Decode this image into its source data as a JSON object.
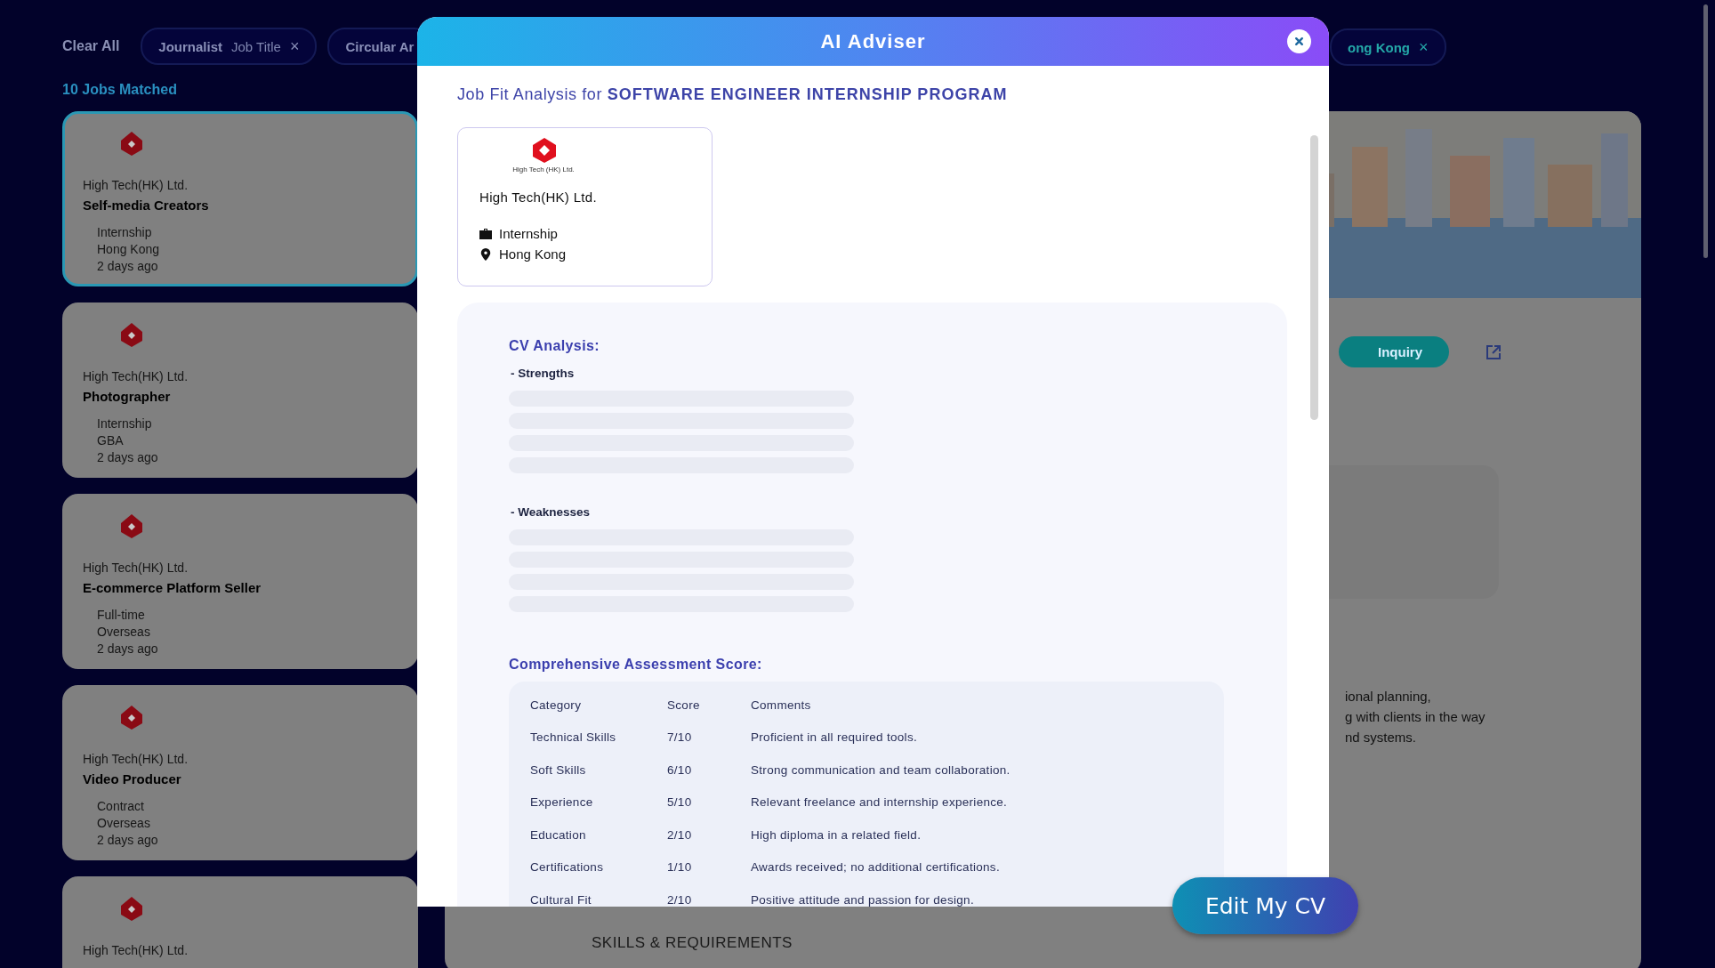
{
  "background": {
    "clear_label": "Clear All",
    "chips": [
      {
        "value": "Journalist",
        "field": "Job Title",
        "remove": "×"
      },
      {
        "value": "Circular Ar"
      }
    ],
    "right_chip": {
      "value": "ong Kong",
      "remove": "×"
    },
    "jobs_matched": "10 Jobs Matched",
    "jobs": [
      {
        "company": "High Tech(HK) Ltd.",
        "title": "Self-media Creators",
        "type": "Internship",
        "location": "Hong Kong",
        "posted": "2 days ago",
        "selected": true
      },
      {
        "company": "High Tech(HK) Ltd.",
        "title": "Photographer",
        "type": "Internship",
        "location": "GBA",
        "posted": "2 days ago",
        "selected": false
      },
      {
        "company": "High Tech(HK) Ltd.",
        "title": "E-commerce Platform Seller",
        "type": "Full-time",
        "location": "Overseas",
        "posted": "2 days ago",
        "selected": false
      },
      {
        "company": "High Tech(HK) Ltd.",
        "title": "Video Producer",
        "type": "Contract",
        "location": "Overseas",
        "posted": "2 days ago",
        "selected": false
      },
      {
        "company": "High Tech(HK) Ltd.",
        "selected": false
      }
    ],
    "detail": {
      "inquiry": "Inquiry",
      "description_lines": [
        "ional planning,",
        "g with clients in the way",
        "nd systems."
      ],
      "section": "SKILLS & REQUIREMENTS"
    }
  },
  "modal": {
    "title": "AI Adviser",
    "heading_prefix": "Job Fit Analysis for",
    "heading_job": "SOFTWARE ENGINEER INTERNSHIP PROGRAM",
    "company": {
      "logo_caption": "High Tech (HK) Ltd.",
      "name": "High Tech(HK) Ltd.",
      "type": "Internship",
      "location": "Hong Kong"
    },
    "cv_analysis": {
      "title": "CV Analysis:",
      "sections": [
        {
          "label": "- Strengths",
          "loading": true
        },
        {
          "label": "- Weaknesses",
          "loading": true
        }
      ]
    },
    "assessment": {
      "title": "Comprehensive Assessment Score:",
      "columns": [
        "Category",
        "Score",
        "Comments"
      ],
      "rows": [
        [
          "Technical Skills",
          "7/10",
          "Proficient in all required tools."
        ],
        [
          "Soft Skills",
          "6/10",
          "Strong communication and team collaboration."
        ],
        [
          "Experience",
          "5/10",
          "Relevant freelance and internship experience."
        ],
        [
          "Education",
          "2/10",
          "High diploma in a related field."
        ],
        [
          "Certifications",
          "1/10",
          "Awards received; no additional certifications."
        ],
        [
          "Cultural Fit",
          "2/10",
          "Positive attitude and passion for design."
        ]
      ]
    }
  },
  "edit_button": "Edit My CV"
}
